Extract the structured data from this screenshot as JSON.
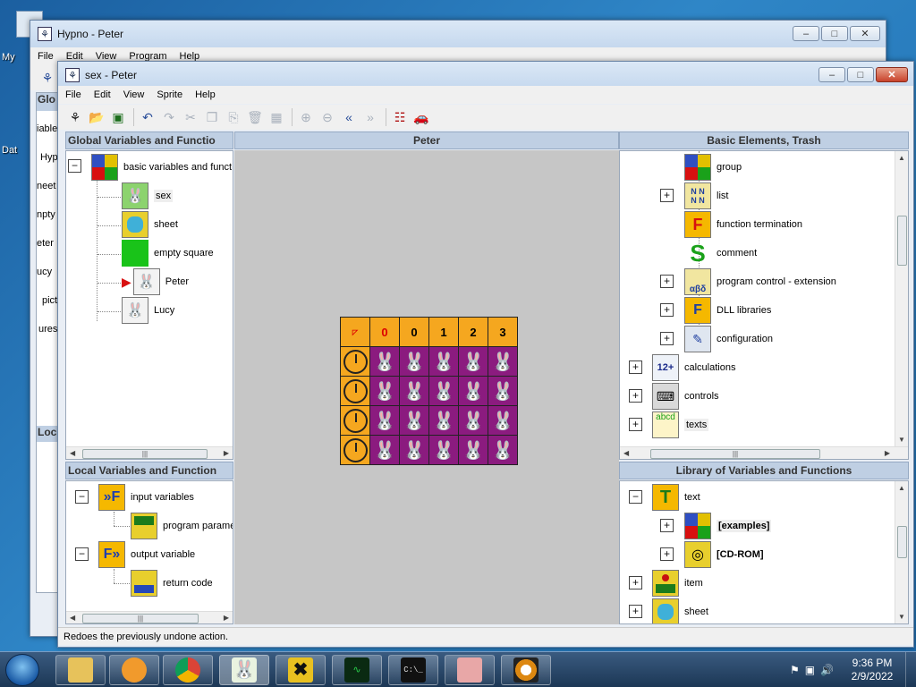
{
  "desktop": {
    "labels": [
      "My",
      "Dat"
    ]
  },
  "back_window": {
    "title": "Hypno - Peter",
    "menu": [
      "File",
      "Edit",
      "View",
      "Program",
      "Help"
    ],
    "side_fragments": [
      "Glo",
      "iable",
      "Hyp",
      "neet",
      "npty",
      "eter",
      "ucy",
      "pictu",
      "ures",
      "Loc"
    ]
  },
  "main_window": {
    "title": "sex - Peter",
    "menu": [
      "File",
      "Edit",
      "View",
      "Sprite",
      "Help"
    ],
    "panes": {
      "global_header": "Global Variables and Functio",
      "center_header": "Peter",
      "basic_header": "Basic Elements, Trash",
      "local_header": "Local Variables and Function",
      "library_header": "Library of Variables and Functions"
    },
    "global_tree": [
      {
        "label": "basic variables and funct"
      },
      {
        "label": "sex"
      },
      {
        "label": "sheet"
      },
      {
        "label": "empty square"
      },
      {
        "label": "Peter"
      },
      {
        "label": "Lucy"
      }
    ],
    "basic_tree": [
      {
        "label": "group"
      },
      {
        "label": "list"
      },
      {
        "label": "function termination"
      },
      {
        "label": "comment"
      },
      {
        "label": "program control - extension"
      },
      {
        "label": "DLL libraries"
      },
      {
        "label": "configuration"
      },
      {
        "label": "calculations"
      },
      {
        "label": "controls"
      },
      {
        "label": "texts"
      }
    ],
    "local_tree": [
      {
        "label": "input variables"
      },
      {
        "label": "program parame"
      },
      {
        "label": "output variable"
      },
      {
        "label": "return code"
      }
    ],
    "library_tree": [
      {
        "label": "text"
      },
      {
        "label": "[examples]"
      },
      {
        "label": "[CD-ROM]"
      },
      {
        "label": "item"
      },
      {
        "label": "sheet"
      }
    ],
    "sheet_header_numbers": [
      "0",
      "0",
      "1",
      "2",
      "3"
    ],
    "status": "Redoes the previously undone action."
  },
  "taskbar": {
    "time": "9:36 PM",
    "date": "2/9/2022"
  },
  "colors": {
    "accent_orange": "#f5a71f",
    "grid_purple": "#8b1b7f",
    "pane_header": "#bfcfe3"
  }
}
